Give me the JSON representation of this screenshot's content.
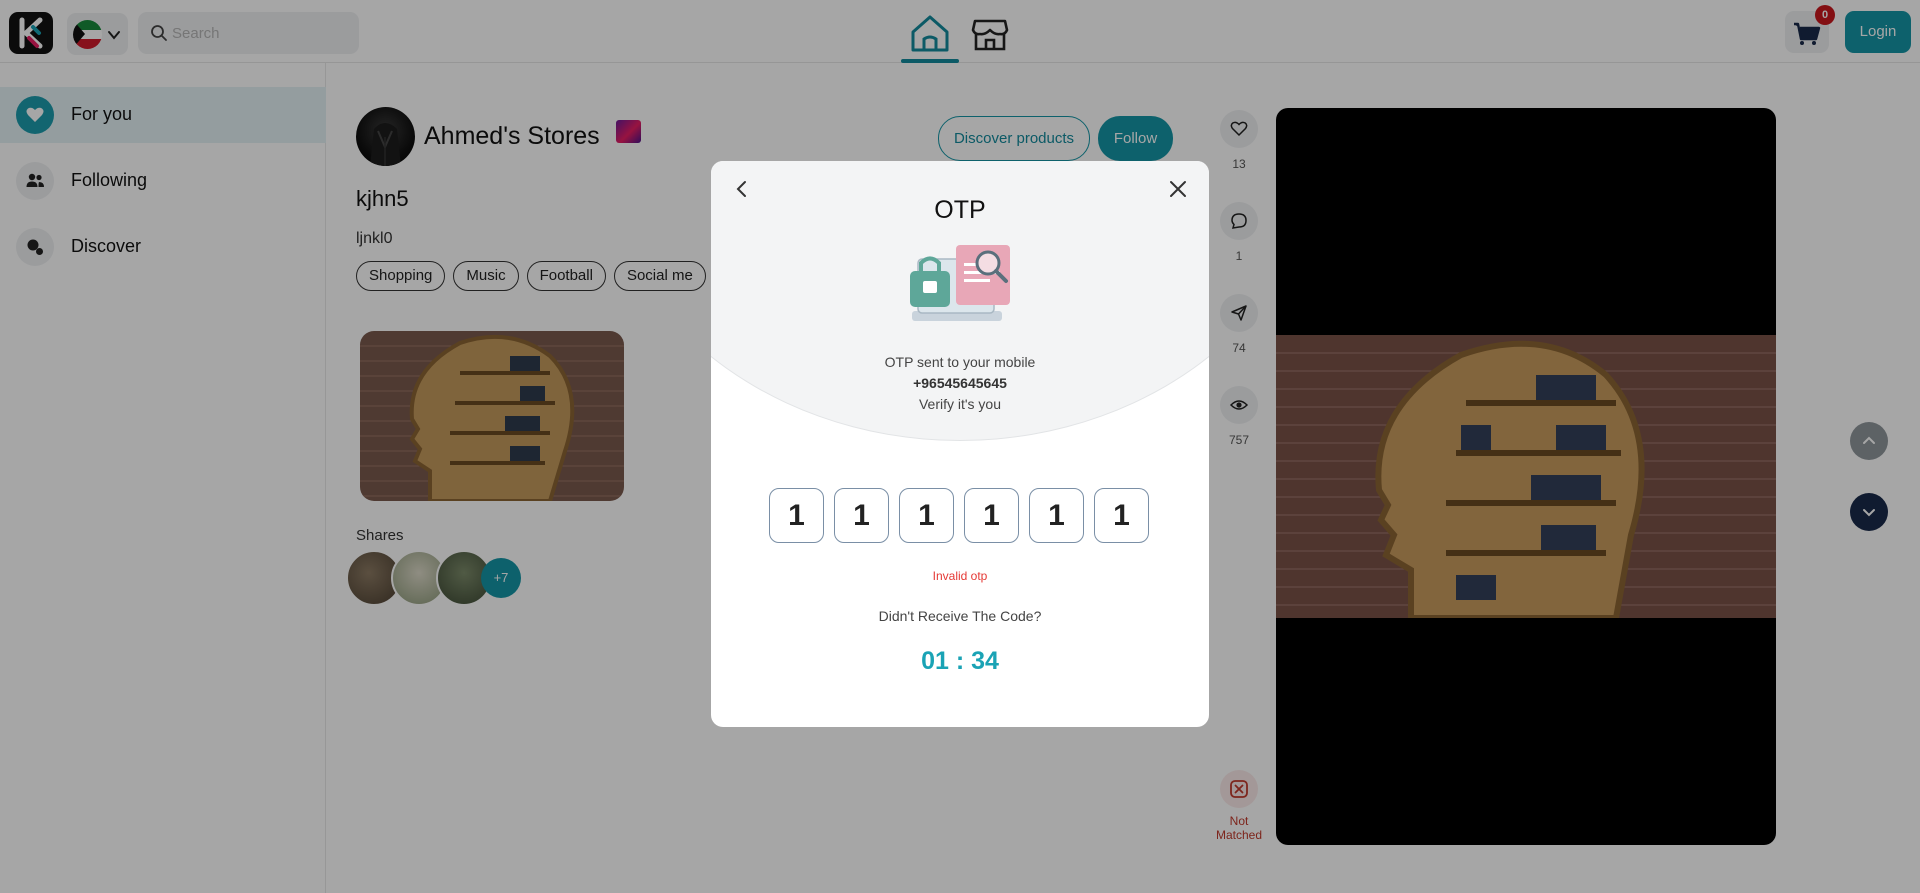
{
  "header": {
    "search_placeholder": "Search",
    "cart_count": "0",
    "login_label": "Login"
  },
  "sidebar": {
    "items": [
      {
        "label": "For you",
        "icon": "heart-icon",
        "active": true
      },
      {
        "label": "Following",
        "icon": "users-icon",
        "active": false
      },
      {
        "label": "Discover",
        "icon": "discover-icon",
        "active": false
      }
    ]
  },
  "profile": {
    "store_name": "Ahmed's Stores",
    "discover_label": "Discover products",
    "follow_label": "Follow",
    "post_title": "kjhn5",
    "post_subtitle": "ljnkl0",
    "tags": [
      "Shopping",
      "Music",
      "Football",
      "Social me"
    ],
    "shares_label": "Shares",
    "shares_more": "+7"
  },
  "stats": {
    "likes": "13",
    "comments": "1",
    "shares": "74",
    "views": "757",
    "status": "Not Matched"
  },
  "modal": {
    "title": "OTP",
    "sent_text": "OTP sent to your mobile",
    "phone": "+96545645645",
    "verify_text": "Verify it's you",
    "otp_digits": [
      "1",
      "1",
      "1",
      "1",
      "1",
      "1"
    ],
    "error_text": "Invalid otp",
    "resend_text": "Didn't Receive The Code?",
    "timer": "01 : 34"
  },
  "colors": {
    "accent": "#1496a6",
    "error": "#e53935",
    "timer": "#1aa3b5",
    "cart_badge": "#c9171e"
  }
}
